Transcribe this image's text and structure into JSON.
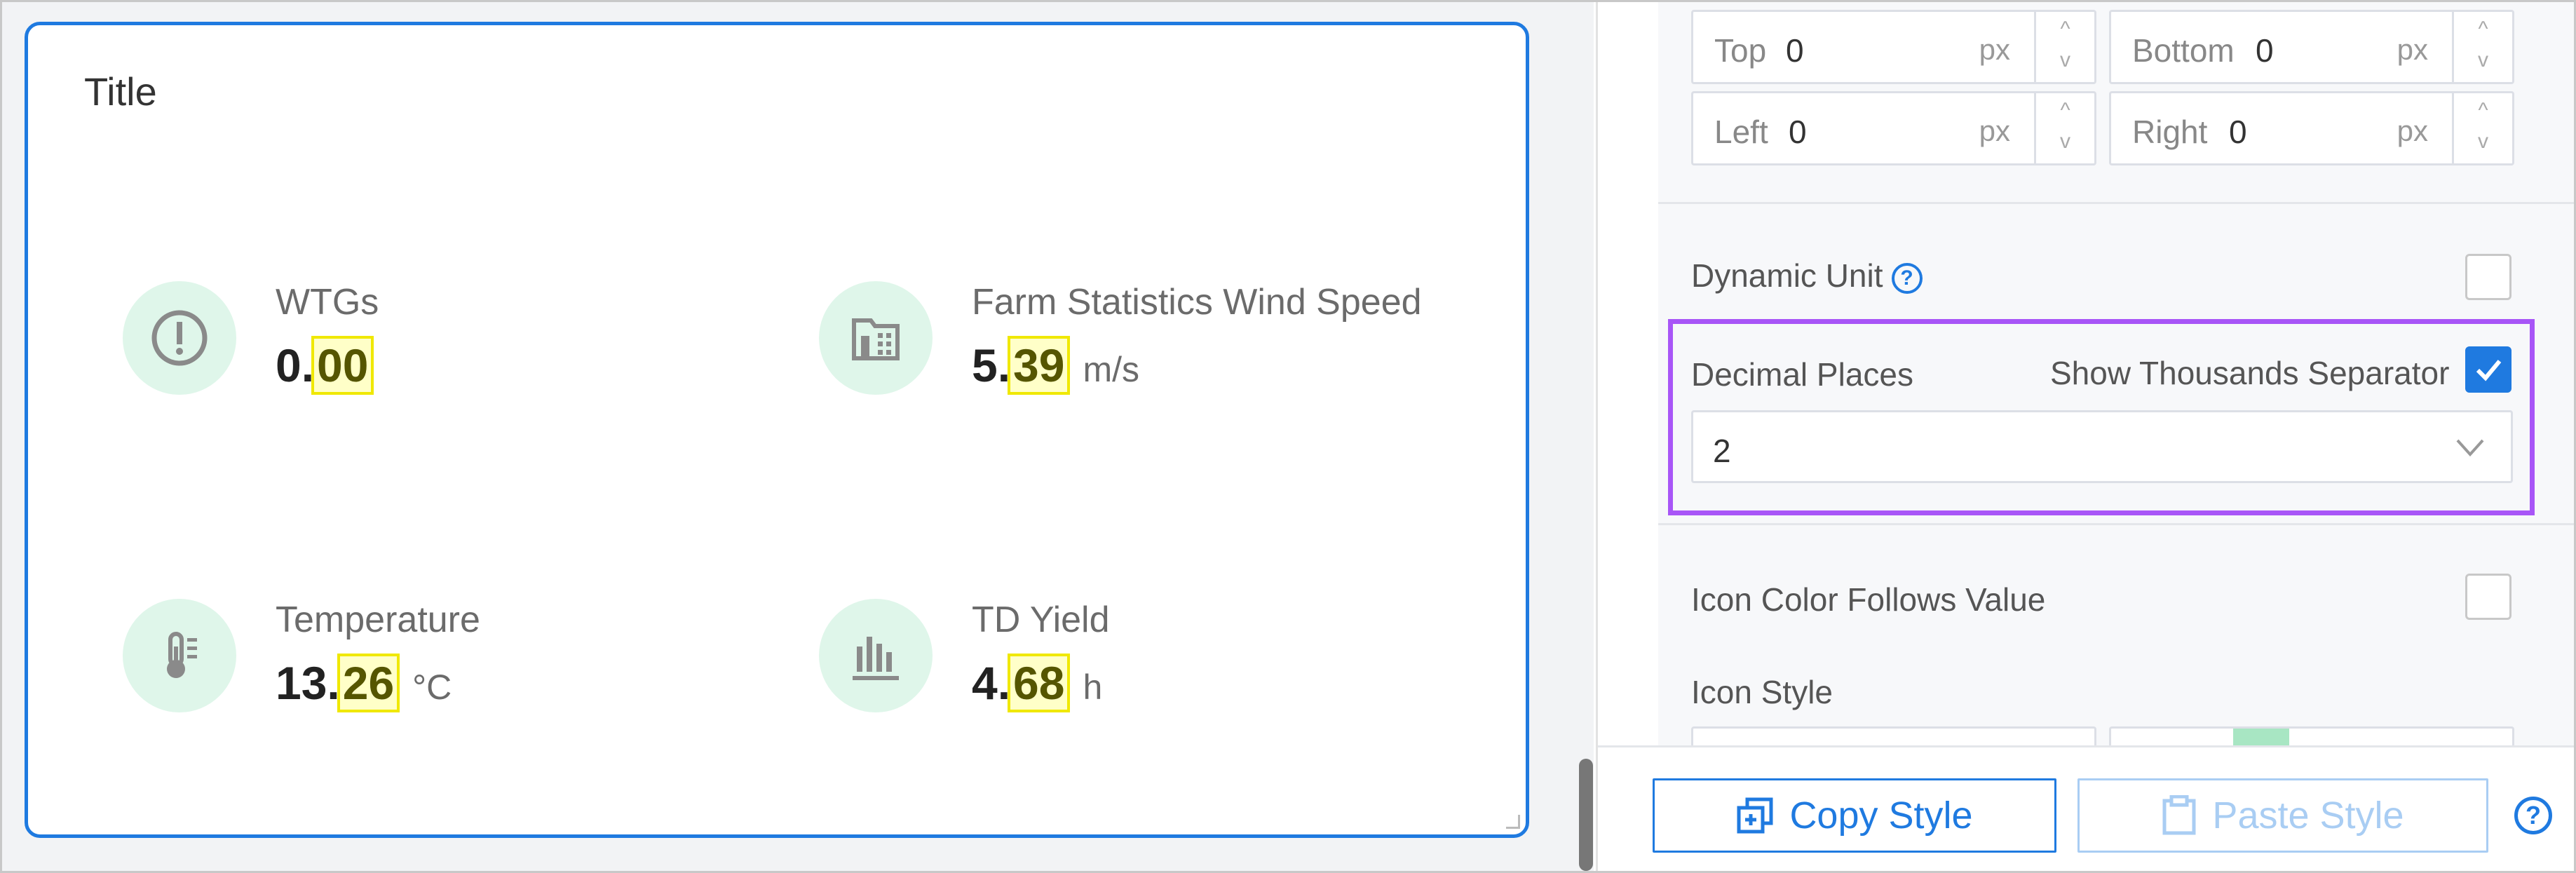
{
  "card": {
    "title": "Title",
    "metrics": [
      {
        "label": "WTGs",
        "int": "0.",
        "dec": "00",
        "unit": ""
      },
      {
        "label": "Farm Statistics Wind Speed",
        "int": "5.",
        "dec": "39",
        "unit": "m/s"
      },
      {
        "label": "Temperature",
        "int": "13.",
        "dec": "26",
        "unit": "°C"
      },
      {
        "label": "TD Yield",
        "int": "4.",
        "dec": "68",
        "unit": "h"
      }
    ]
  },
  "panel": {
    "padding": {
      "top_label": "Top",
      "top_value": "0",
      "bottom_label": "Bottom",
      "bottom_value": "0",
      "left_label": "Left",
      "left_value": "0",
      "right_label": "Right",
      "right_value": "0",
      "unit": "px",
      "up": "^",
      "down": "v"
    },
    "dynamic_unit_label": "Dynamic Unit",
    "decimal_places_label": "Decimal Places",
    "thousands_label": "Show Thousands Separator",
    "decimal_places_value": "2",
    "icon_color_follows_label": "Icon Color Follows Value",
    "icon_style_label": "Icon Style",
    "help_glyph": "?"
  },
  "bottom": {
    "copy_label": "Copy Style",
    "paste_label": "Paste Style"
  },
  "colors": {
    "accent": "#1f7ae0",
    "highlight": "#a855f7",
    "icon_bg": "#dff6ea"
  }
}
